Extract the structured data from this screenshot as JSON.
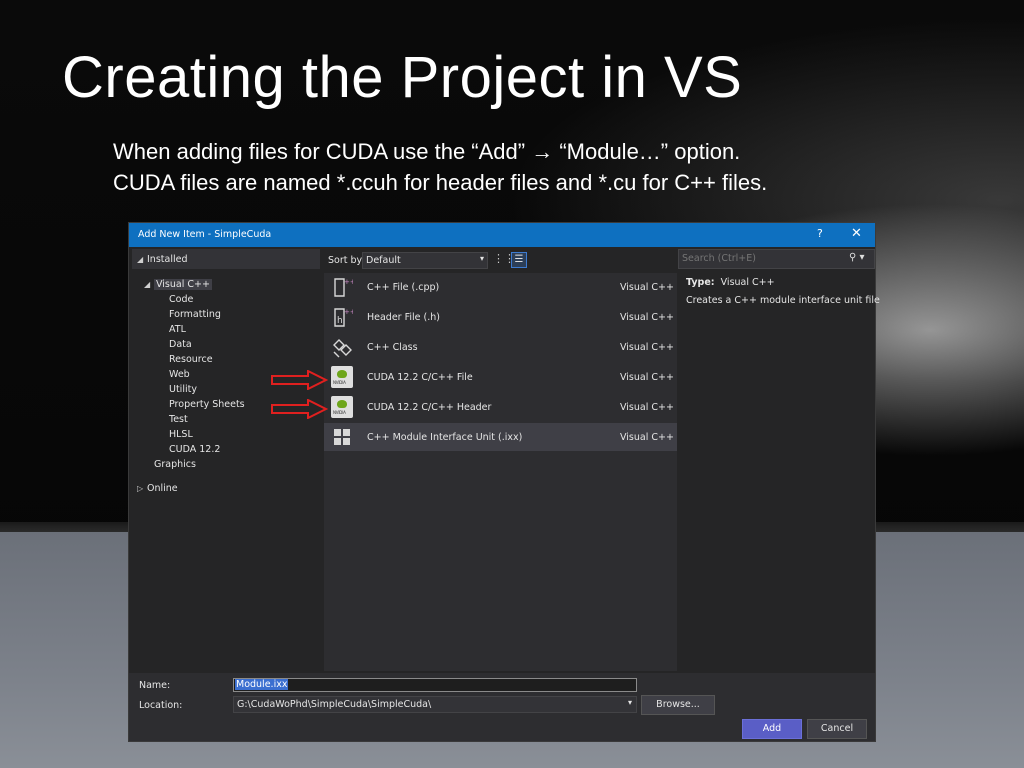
{
  "slide": {
    "title": "Creating the Project in VS",
    "lines": [
      "When adding files for CUDA use the “Add” → “Module…” option.",
      "CUDA files are named *.ccuh for header files and *.cu for C++ files."
    ]
  },
  "dialog": {
    "title": "Add New Item - SimpleCuda",
    "help": "?",
    "close": "✕",
    "installed_label": "Installed",
    "tree": {
      "root": "Visual C++",
      "children": [
        "Code",
        "Formatting",
        "ATL",
        "Data",
        "Resource",
        "Web",
        "Utility",
        "Property Sheets",
        "Test",
        "HLSL",
        "CUDA 12.2"
      ],
      "graphics": "Graphics",
      "online": "Online"
    },
    "sort_by_label": "Sort by:",
    "sort_by_value": "Default",
    "templates": [
      {
        "name": "C++ File (.cpp)",
        "lang": "Visual C++",
        "icon": "cpp-file-icon"
      },
      {
        "name": "Header File (.h)",
        "lang": "Visual C++",
        "icon": "header-file-icon"
      },
      {
        "name": "C++ Class",
        "lang": "Visual C++",
        "icon": "cpp-class-icon"
      },
      {
        "name": "CUDA 12.2 C/C++ File",
        "lang": "Visual C++",
        "icon": "nvidia-icon"
      },
      {
        "name": "CUDA 12.2 C/C++ Header",
        "lang": "Visual C++",
        "icon": "nvidia-icon"
      },
      {
        "name": "C++ Module Interface Unit (.ixx)",
        "lang": "Visual C++",
        "icon": "module-icon",
        "selected": true
      }
    ],
    "nvidia_text": "NVIDIA",
    "search_placeholder": "Search (Ctrl+E)",
    "details": {
      "type_label": "Type:",
      "type_value": "Visual C++",
      "description": "Creates a C++ module interface unit file"
    },
    "name_label": "Name:",
    "name_value": "Module.ixx",
    "location_label": "Location:",
    "location_value": "G:\\CudaWoPhd\\SimpleCuda\\SimpleCuda\\",
    "browse_label": "Browse...",
    "add_label": "Add",
    "cancel_label": "Cancel",
    "colors": {
      "titlebar": "#0e70c0",
      "add_button": "#5a5ec6",
      "annotation_arrow": "#e0201f",
      "nvidia_green": "#76b900"
    }
  }
}
